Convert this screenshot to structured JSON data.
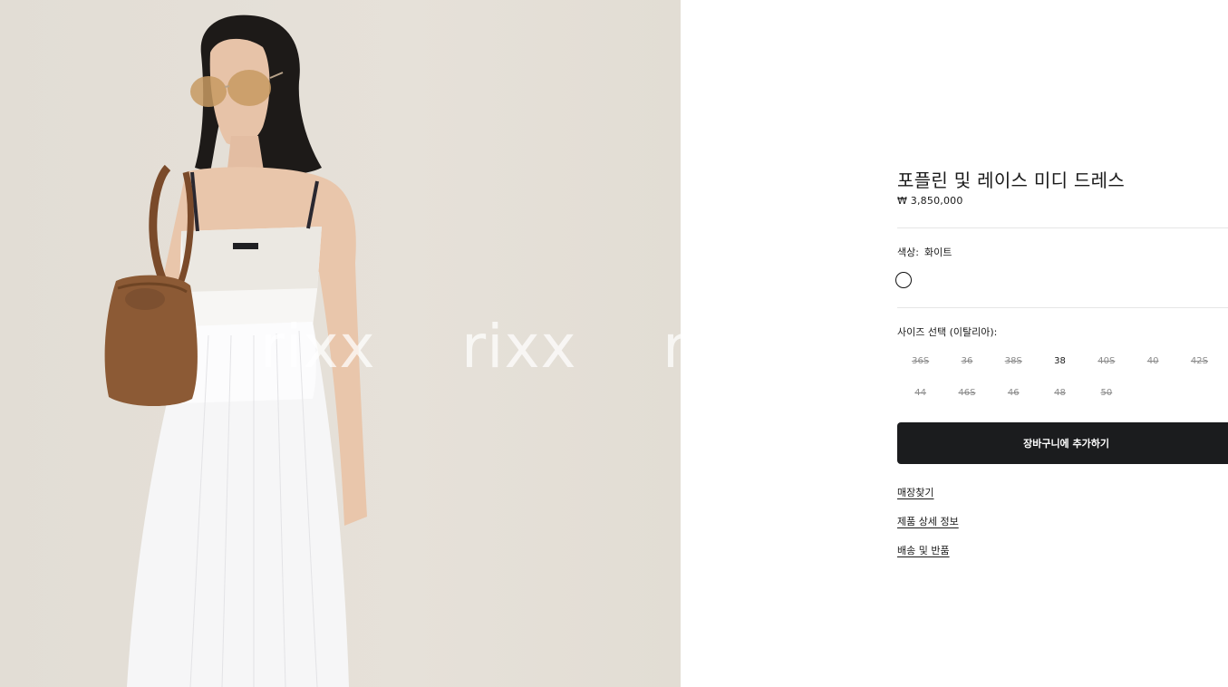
{
  "image": {
    "watermarks": [
      "rixx",
      "rixx",
      "rixx"
    ]
  },
  "product": {
    "title": "포플린 및 레이스 미디 드레스",
    "price": "₩ 3,850,000"
  },
  "color": {
    "label": "색상:",
    "value": "화이트",
    "swatches": [
      {
        "name": "화이트",
        "hex": "#ffffff",
        "selected": true
      }
    ]
  },
  "size": {
    "heading": "사이즈 선택 (이탈리아):",
    "options": [
      {
        "label": "36S",
        "available": false
      },
      {
        "label": "36",
        "available": false
      },
      {
        "label": "38S",
        "available": false
      },
      {
        "label": "38",
        "available": true
      },
      {
        "label": "40S",
        "available": false
      },
      {
        "label": "40",
        "available": false
      },
      {
        "label": "42S",
        "available": false
      },
      {
        "label": "44",
        "available": false
      },
      {
        "label": "46S",
        "available": false
      },
      {
        "label": "46",
        "available": false
      },
      {
        "label": "48",
        "available": false
      },
      {
        "label": "50",
        "available": false
      }
    ]
  },
  "actions": {
    "add_to_cart": "장바구니에 추가하기"
  },
  "links": {
    "find_store": "매장찾기",
    "product_details": "제품 상세 정보",
    "shipping_returns": "배송 및 반품"
  },
  "colors": {
    "button_bg": "#1b1c1e",
    "photo_bg": "#e4dfd7"
  }
}
